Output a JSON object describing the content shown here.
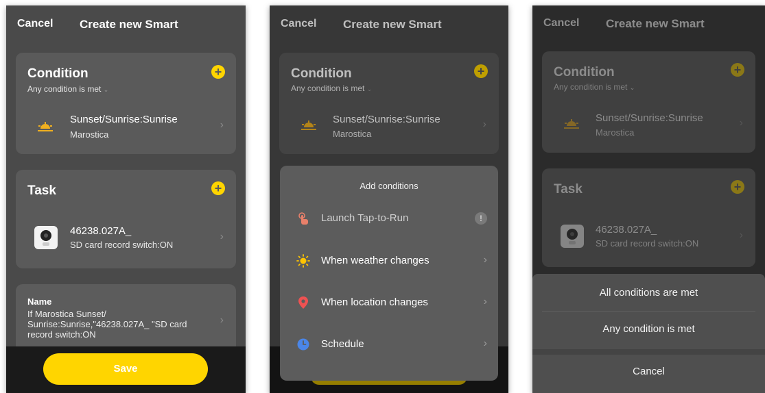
{
  "colors": {
    "accent": "#ffd500",
    "background": "#4a4a4a",
    "card": "#5a5a5a",
    "sheet": "#5c5c5c"
  },
  "header": {
    "cancel": "Cancel",
    "title": "Create new Smart"
  },
  "condition": {
    "title": "Condition",
    "mode": "Any condition is met",
    "item": {
      "title": "Sunset/Sunrise:Sunrise",
      "subtitle": "Marostica",
      "icon": "sunrise-icon"
    }
  },
  "task": {
    "title": "Task",
    "item": {
      "title": "46238.027A_",
      "subtitle": "SD card record switch:ON",
      "icon": "camera-icon"
    }
  },
  "name_card": {
    "label": "Name",
    "line1": "If Marostica Sunset/",
    "line2": "Sunrise:Sunrise,\"46238.027A_ \"SD card",
    "line3": "record switch:ON"
  },
  "save_label": "Save",
  "add_conditions": {
    "title": "Add conditions",
    "options": [
      {
        "label": "Launch Tap-to-Run",
        "icon": "tap-icon"
      },
      {
        "label": "When weather changes",
        "icon": "sun-icon"
      },
      {
        "label": "When location changes",
        "icon": "location-pin-icon"
      },
      {
        "label": "Schedule",
        "icon": "clock-icon"
      }
    ]
  },
  "condition_mode_sheet": {
    "options": [
      "All conditions are met",
      "Any condition is met"
    ],
    "cancel": "Cancel"
  }
}
